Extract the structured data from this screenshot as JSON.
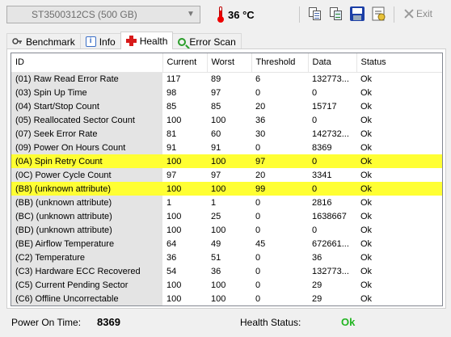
{
  "toolbar": {
    "drive": "ST3500312CS (500 GB)",
    "temperature": "36 °C",
    "exit_label": "Exit"
  },
  "tabs": [
    {
      "label": "Benchmark",
      "icon": "benchmark-icon"
    },
    {
      "label": "Info",
      "icon": "info-icon"
    },
    {
      "label": "Health",
      "icon": "health-cross-icon",
      "active": true
    },
    {
      "label": "Error Scan",
      "icon": "magnifier-icon"
    }
  ],
  "table": {
    "headers": [
      "ID",
      "Current",
      "Worst",
      "Threshold",
      "Data",
      "Status"
    ],
    "rows": [
      {
        "id": "(01) Raw Read Error Rate",
        "current": "117",
        "worst": "89",
        "threshold": "6",
        "data": "132773...",
        "status": "Ok"
      },
      {
        "id": "(03) Spin Up Time",
        "current": "98",
        "worst": "97",
        "threshold": "0",
        "data": "0",
        "status": "Ok"
      },
      {
        "id": "(04) Start/Stop Count",
        "current": "85",
        "worst": "85",
        "threshold": "20",
        "data": "15717",
        "status": "Ok"
      },
      {
        "id": "(05) Reallocated Sector Count",
        "current": "100",
        "worst": "100",
        "threshold": "36",
        "data": "0",
        "status": "Ok"
      },
      {
        "id": "(07) Seek Error Rate",
        "current": "81",
        "worst": "60",
        "threshold": "30",
        "data": "142732...",
        "status": "Ok"
      },
      {
        "id": "(09) Power On Hours Count",
        "current": "91",
        "worst": "91",
        "threshold": "0",
        "data": "8369",
        "status": "Ok"
      },
      {
        "id": "(0A) Spin Retry Count",
        "current": "100",
        "worst": "100",
        "threshold": "97",
        "data": "0",
        "status": "Ok",
        "highlight": true
      },
      {
        "id": "(0C) Power Cycle Count",
        "current": "97",
        "worst": "97",
        "threshold": "20",
        "data": "3341",
        "status": "Ok"
      },
      {
        "id": "(B8) (unknown attribute)",
        "current": "100",
        "worst": "100",
        "threshold": "99",
        "data": "0",
        "status": "Ok",
        "highlight": true
      },
      {
        "id": "(BB) (unknown attribute)",
        "current": "1",
        "worst": "1",
        "threshold": "0",
        "data": "2816",
        "status": "Ok"
      },
      {
        "id": "(BC) (unknown attribute)",
        "current": "100",
        "worst": "25",
        "threshold": "0",
        "data": "1638667",
        "status": "Ok"
      },
      {
        "id": "(BD) (unknown attribute)",
        "current": "100",
        "worst": "100",
        "threshold": "0",
        "data": "0",
        "status": "Ok"
      },
      {
        "id": "(BE) Airflow Temperature",
        "current": "64",
        "worst": "49",
        "threshold": "45",
        "data": "672661...",
        "status": "Ok"
      },
      {
        "id": "(C2) Temperature",
        "current": "36",
        "worst": "51",
        "threshold": "0",
        "data": "36",
        "status": "Ok"
      },
      {
        "id": "(C3) Hardware ECC Recovered",
        "current": "54",
        "worst": "36",
        "threshold": "0",
        "data": "132773...",
        "status": "Ok"
      },
      {
        "id": "(C5) Current Pending Sector",
        "current": "100",
        "worst": "100",
        "threshold": "0",
        "data": "29",
        "status": "Ok"
      },
      {
        "id": "(C6) Offline Uncorrectable",
        "current": "100",
        "worst": "100",
        "threshold": "0",
        "data": "29",
        "status": "Ok"
      }
    ]
  },
  "statusbar": {
    "power_on_label": "Power On Time:",
    "power_on_value": "8369",
    "health_label": "Health Status:",
    "health_value": "Ok"
  },
  "colors": {
    "highlight": "#ffff33",
    "health_ok": "#22b522",
    "temperature_icon": "#e00000"
  }
}
